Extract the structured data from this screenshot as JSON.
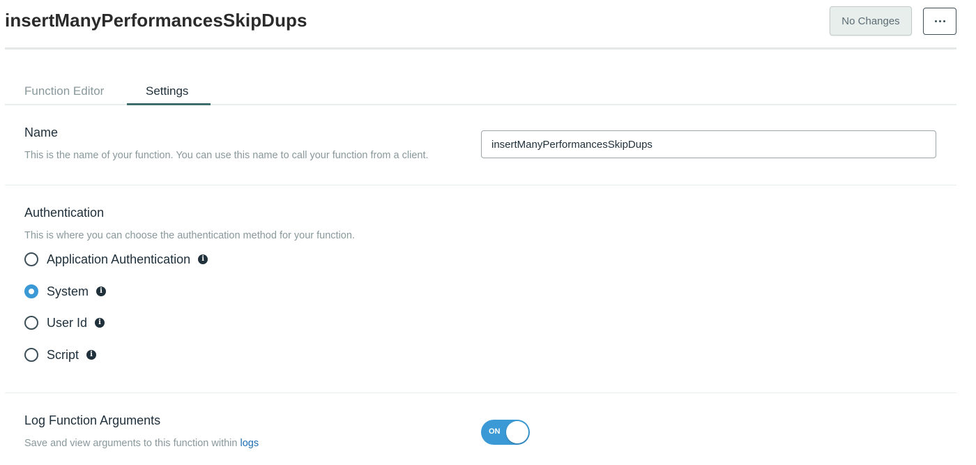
{
  "header": {
    "title": "insertManyPerformancesSkipDups",
    "save_button": "No Changes",
    "more_button": "···"
  },
  "tabs": [
    {
      "label": "Function Editor",
      "active": false
    },
    {
      "label": "Settings",
      "active": true
    }
  ],
  "name_section": {
    "title": "Name",
    "description": "This is the name of your function. You can use this name to call your function from a client.",
    "value": "insertManyPerformancesSkipDups"
  },
  "auth_section": {
    "title": "Authentication",
    "description": "This is where you can choose the authentication method for your function.",
    "options": [
      {
        "label": "Application Authentication",
        "selected": false
      },
      {
        "label": "System",
        "selected": true
      },
      {
        "label": "User Id",
        "selected": false
      },
      {
        "label": "Script",
        "selected": false
      }
    ]
  },
  "log_section": {
    "title": "Log Function Arguments",
    "description": "Save and view arguments to this function within",
    "link_text": "logs",
    "toggle_label": "ON",
    "toggle_on": true
  },
  "colors": {
    "accent": "#3b9ad5",
    "tab_underline": "#3f6d6c",
    "link": "#1a6bb3"
  }
}
